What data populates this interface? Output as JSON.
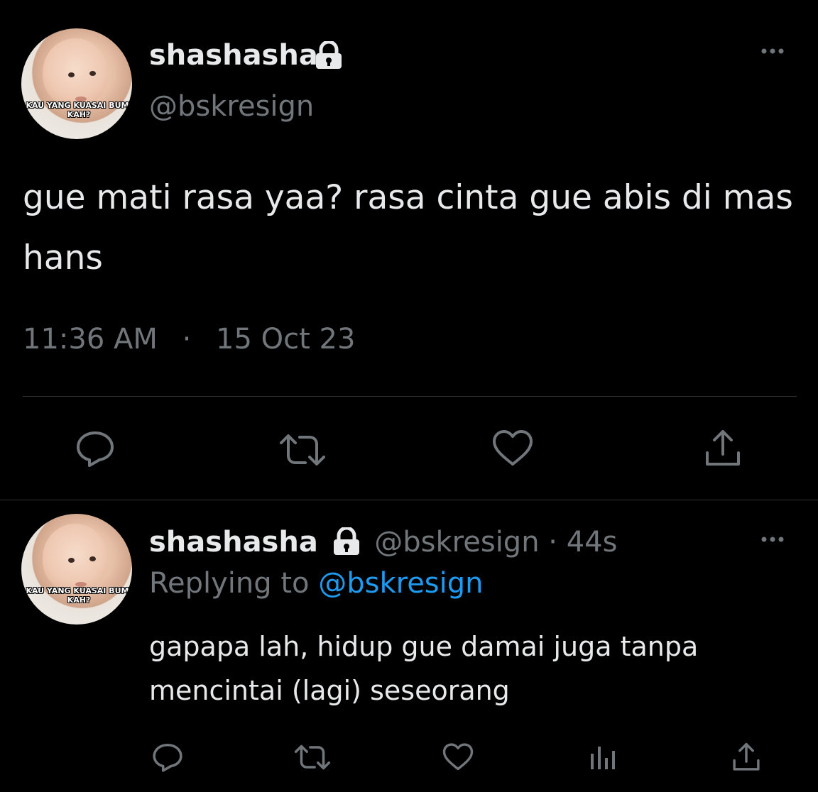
{
  "main_tweet": {
    "display_name": "shashasha",
    "handle": "@bskresign",
    "avatar_caption": "KAU YANG KUASAI BUMI KAH?",
    "text": "gue mati rasa yaa? rasa cinta gue abis di mas hans",
    "time": "11:36 AM",
    "separator": "·",
    "date": "15 Oct 23",
    "more_label": "···"
  },
  "reply_tweet": {
    "display_name": "shashasha",
    "handle": "@bskresign",
    "age": "· 44s",
    "replying_prefix": "Replying to",
    "replying_handle": "@bskresign",
    "avatar_caption": "KAU YANG KUASAI BUMI KAH?",
    "text": "gapapa lah, hidup gue damai juga tanpa mencintai (lagi) seseorang",
    "more_label": "···"
  },
  "icons": {
    "reply": "reply-icon",
    "retweet": "retweet-icon",
    "like": "heart-icon",
    "views": "views-icon",
    "share": "share-icon",
    "lock": "lock-icon"
  },
  "colors": {
    "background": "#000000",
    "text": "#e7e9ea",
    "secondary": "#71767b",
    "link": "#1d9bf0",
    "divider": "#2f3336"
  }
}
